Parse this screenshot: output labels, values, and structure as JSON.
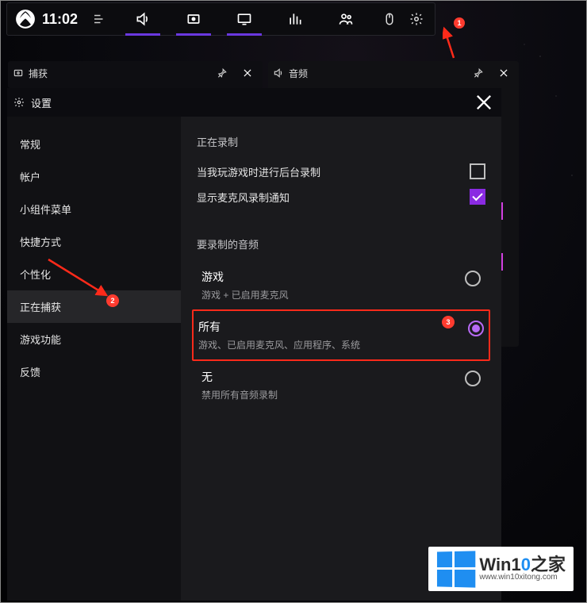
{
  "topbar": {
    "clock": "11:02"
  },
  "annotations": {
    "a1": "1",
    "a2": "2",
    "a3": "3"
  },
  "captureWidget": {
    "title": "捕获"
  },
  "audioWidget": {
    "title": "音频"
  },
  "settings": {
    "title": "设置",
    "sidebar": [
      "常规",
      "帐户",
      "小组件菜单",
      "快捷方式",
      "个性化",
      "正在捕获",
      "游戏功能",
      "反馈"
    ],
    "selectedIndex": 5,
    "section_recording": "正在录制",
    "chk_background": {
      "label": "当我玩游戏时进行后台录制",
      "checked": false
    },
    "chk_mic": {
      "label": "显示麦克风录制通知",
      "checked": true
    },
    "section_audio": "要录制的音频",
    "radios": [
      {
        "title": "游戏",
        "sub": "游戏 + 已启用麦克风"
      },
      {
        "title": "所有",
        "sub": "游戏、已启用麦克风、应用程序、系统"
      },
      {
        "title": "无",
        "sub": "禁用所有音频录制"
      }
    ],
    "radioSelected": 1
  },
  "watermark": {
    "main_pre": "Win1",
    "main_blue": "0",
    "main_post": "之家",
    "sub": "www.win10xitong.com"
  }
}
